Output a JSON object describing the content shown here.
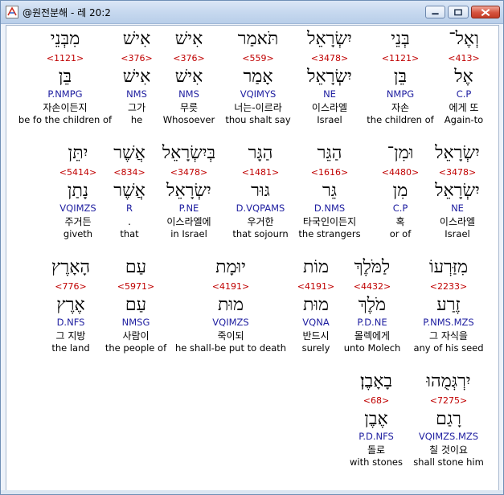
{
  "window": {
    "title": "@원전분해 - 레 20:2"
  },
  "words": [
    {
      "heb": "וְאֶל־",
      "strong": "<413>",
      "lemma": "אֶל",
      "morph": "C.P",
      "kor": "에게 또",
      "eng": "Again-to",
      "selected": true
    },
    {
      "heb": "בְּנֵי",
      "strong": "<1121>",
      "lemma": "בֵּן",
      "morph": "NMPG",
      "kor": "자손",
      "eng": "the children of"
    },
    {
      "heb": "יִשְׂרָאֵל",
      "strong": "<3478>",
      "lemma": "יִשְׂרָאֵל",
      "morph": "NE",
      "kor": "이스라엘",
      "eng": "Israel"
    },
    {
      "heb": "תֹּאמַר",
      "strong": "<559>",
      "lemma": "אָמַר",
      "morph": "VQIMYS",
      "kor": "너는-이르라",
      "eng": "thou shalt say"
    },
    {
      "heb": "אִישׁ",
      "strong": "<376>",
      "lemma": "אִישׁ",
      "morph": "NMS",
      "kor": "무릇",
      "eng": "Whosoever"
    },
    {
      "heb": "אִישׁ",
      "strong": "<376>",
      "lemma": "אִישׁ",
      "morph": "NMS",
      "kor": "그가",
      "eng": "he"
    },
    {
      "heb": "מִבְּנֵי",
      "strong": "<1121>",
      "lemma": "בֵּן",
      "morph": "P.NMPG",
      "kor": "자손이든지",
      "eng": "be fo the children of"
    },
    {
      "heb": "יִשְׂרָאֵל",
      "strong": "<3478>",
      "lemma": "יִשְׂרָאֵל",
      "morph": "NE",
      "kor": "이스라엘",
      "eng": "Israel"
    },
    {
      "heb": "וּמִן־",
      "strong": "<4480>",
      "lemma": "מִן",
      "morph": "C.P",
      "kor": "혹",
      "eng": "or of"
    },
    {
      "heb": "הַגֵּר",
      "strong": "<1616>",
      "lemma": "גֵּר",
      "morph": "D.NMS",
      "kor": "타국인이든지",
      "eng": "the strangers"
    },
    {
      "heb": "הַגָּר",
      "strong": "<1481>",
      "lemma": "גּוּר",
      "morph": "D.VQPAMS",
      "kor": "우거한",
      "eng": "that sojourn"
    },
    {
      "heb": "בְּיִשְׂרָאֵל",
      "strong": "<3478>",
      "lemma": "יִשְׂרָאֵל",
      "morph": "P.NE",
      "kor": "이스라엘에",
      "eng": "in Israel"
    },
    {
      "heb": "אֲשֶׁר",
      "strong": "<834>",
      "lemma": "אֲשֶׁר",
      "morph": "R",
      "kor": ".",
      "eng": "that"
    },
    {
      "heb": "יִתֵּן",
      "strong": "<5414>",
      "lemma": "נָתַן",
      "morph": "VQIMZS",
      "kor": "주거든",
      "eng": "giveth"
    },
    {
      "heb": "מִזַּרְעוֹ",
      "strong": "<2233>",
      "lemma": "זֶרַע",
      "morph": "P.NMS.MZS",
      "kor": "그 자식을",
      "eng": "any of his seed"
    },
    {
      "heb": "לַמֹּלֶךְ",
      "strong": "<4432>",
      "lemma": "מֹלֶךְ",
      "morph": "P.D.NE",
      "kor": "몰렉에게",
      "eng": "unto Molech"
    },
    {
      "heb": "מוֹת",
      "strong": "<4191>",
      "lemma": "מוּת",
      "morph": "VQNA",
      "kor": "반드시",
      "eng": "surely"
    },
    {
      "heb": "יוּמָת",
      "strong": "<4191>",
      "lemma": "מוּת",
      "morph": "VQIMZS",
      "kor": "죽이되",
      "eng": "he shall-be put to death"
    },
    {
      "heb": "עַם",
      "strong": "<5971>",
      "lemma": "עַם",
      "morph": "NMSG",
      "kor": "사람이",
      "eng": "the people of"
    },
    {
      "heb": "הָאָרֶץ",
      "strong": "<776>",
      "lemma": "אֶרֶץ",
      "morph": "D.NFS",
      "kor": "그 지방",
      "eng": "the land"
    },
    {
      "heb": "יִרְגְּמֻהוּ",
      "strong": "<7275>",
      "lemma": "רָגַם",
      "morph": "VQIMZS.MZS",
      "kor": "칠 것이요",
      "eng": "shall stone him"
    },
    {
      "heb": "בָאָבֶן׃",
      "strong": "<68>",
      "lemma": "אֶבֶן",
      "morph": "P.D.NFS",
      "kor": "돌로",
      "eng": "with stones"
    }
  ]
}
